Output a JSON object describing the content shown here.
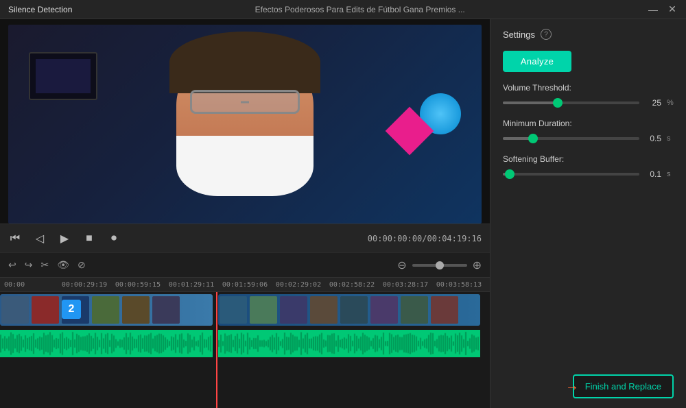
{
  "titlebar": {
    "app_name": "Silence Detection",
    "video_title": "Efectos Poderosos Para Edits de Fútbol   Gana Premios ...",
    "minimize_label": "—",
    "close_label": "✕"
  },
  "settings": {
    "title": "Settings",
    "help_icon": "?",
    "analyze_label": "Analyze",
    "volume_threshold": {
      "label": "Volume Threshold:",
      "value": 25,
      "unit": "%",
      "fill_percent": 40,
      "thumb_percent": 40
    },
    "minimum_duration": {
      "label": "Minimum Duration:",
      "value": "0.5",
      "unit": "s",
      "fill_percent": 22,
      "thumb_percent": 22
    },
    "softening_buffer": {
      "label": "Softening Buffer:",
      "value": "0.1",
      "unit": "s",
      "fill_percent": 5,
      "thumb_percent": 5
    }
  },
  "playback": {
    "time_current": "00:00:00:00",
    "time_total": "00:04:19:16",
    "time_separator": "/"
  },
  "timeline": {
    "ruler_marks": [
      "00:00",
      "00:00:29:19",
      "00:00:59:15",
      "00:01:29:11",
      "00:01:59:06",
      "00:02:29:02",
      "00:02:58:22",
      "00:03:28:17",
      "00:03:58:13"
    ],
    "clip_badge": "2"
  },
  "finish_button": {
    "label": "Finish and Replace",
    "arrow": "→"
  },
  "icons": {
    "undo": "↩",
    "redo": "↪",
    "scissors": "✂",
    "eye": "👁",
    "slash_circle": "⊘",
    "zoom_minus": "⊖",
    "zoom_plus": "⊕",
    "rewind": "⏮",
    "play_back": "◁",
    "play": "▶",
    "stop": "■",
    "record": "⏺"
  }
}
